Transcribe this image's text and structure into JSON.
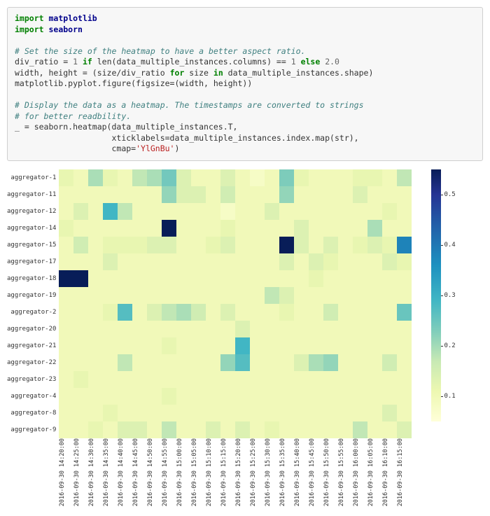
{
  "code": {
    "line1_import": "import",
    "line1_mod": "matplotlib",
    "line2_import": "import",
    "line2_mod": "seaborn",
    "c1": "# Set the size of the heatmap to have a better aspect ratio.",
    "l3a": "div_ratio = ",
    "l3_num1": "1",
    "l3_if": " if ",
    "l3b": "len",
    "l3c": "(data_multiple_instances.columns) == ",
    "l3_num1b": "1",
    "l3_else": " else ",
    "l3_num2": "2.0",
    "l4a": "width, height = (size/div_ratio ",
    "l4_for": "for",
    "l4b": " size ",
    "l4_in": "in",
    "l4c": " data_multiple_instances.shape)",
    "l5": "matplotlib.pyplot.figure(figsize=(width, height))",
    "c2": "# Display the data as a heatmap. The timestamps are converted to strings",
    "c3": "# for better readbility.",
    "l6": "_ = seaborn.heatmap(data_multiple_instances.T,",
    "l7a": "                    xticklabels=data_multiple_instances.index.map(",
    "l7b": "str",
    "l7c": "),",
    "l8a": "                    cmap=",
    "l8s": "'YlGnBu'",
    "l8b": ")"
  },
  "chart_data": {
    "type": "heatmap",
    "xlabel": "",
    "ylabel": "",
    "title": "",
    "cmap": "YlGnBu",
    "vmin": 0.05,
    "vmax": 0.55,
    "colorbar_ticks": [
      0.1,
      0.2,
      0.3,
      0.4,
      0.5
    ],
    "y_categories": [
      "aggregator-1",
      "aggregator-11",
      "aggregator-12",
      "aggregator-14",
      "aggregator-15",
      "aggregator-17",
      "aggregator-18",
      "aggregator-19",
      "aggregator-2",
      "aggregator-20",
      "aggregator-21",
      "aggregator-22",
      "aggregator-23",
      "aggregator-4",
      "aggregator-8",
      "aggregator-9"
    ],
    "x_categories": [
      "2016-09-30 14:20:00",
      "2016-09-30 14:25:00",
      "2016-09-30 14:30:00",
      "2016-09-30 14:35:00",
      "2016-09-30 14:40:00",
      "2016-09-30 14:45:00",
      "2016-09-30 14:50:00",
      "2016-09-30 14:55:00",
      "2016-09-30 15:00:00",
      "2016-09-30 15:05:00",
      "2016-09-30 15:10:00",
      "2016-09-30 15:15:00",
      "2016-09-30 15:20:00",
      "2016-09-30 15:25:00",
      "2016-09-30 15:30:00",
      "2016-09-30 15:35:00",
      "2016-09-30 15:40:00",
      "2016-09-30 15:45:00",
      "2016-09-30 15:50:00",
      "2016-09-30 15:55:00",
      "2016-09-30 16:00:00",
      "2016-09-30 16:05:00",
      "2016-09-30 16:10:00",
      "2016-09-30 16:15:00"
    ],
    "z": [
      [
        0.12,
        0.1,
        0.2,
        0.12,
        0.1,
        0.18,
        0.2,
        0.25,
        0.14,
        0.1,
        0.1,
        0.14,
        0.1,
        0.08,
        0.1,
        0.24,
        0.12,
        0.1,
        0.1,
        0.1,
        0.12,
        0.12,
        0.1,
        0.18
      ],
      [
        0.1,
        0.1,
        0.1,
        0.1,
        0.1,
        0.1,
        0.1,
        0.22,
        0.14,
        0.14,
        0.1,
        0.16,
        0.1,
        0.1,
        0.1,
        0.22,
        0.1,
        0.1,
        0.1,
        0.1,
        0.14,
        0.1,
        0.1,
        0.1
      ],
      [
        0.1,
        0.14,
        0.1,
        0.3,
        0.18,
        0.1,
        0.1,
        0.1,
        0.1,
        0.1,
        0.1,
        0.08,
        0.1,
        0.1,
        0.14,
        0.1,
        0.1,
        0.1,
        0.1,
        0.1,
        0.1,
        0.1,
        0.12,
        0.1
      ],
      [
        0.12,
        0.1,
        0.1,
        0.1,
        0.1,
        0.1,
        0.1,
        0.55,
        0.1,
        0.1,
        0.1,
        0.12,
        0.1,
        0.1,
        0.1,
        0.1,
        0.14,
        0.1,
        0.1,
        0.1,
        0.1,
        0.2,
        0.1,
        0.1
      ],
      [
        0.1,
        0.16,
        0.1,
        0.12,
        0.12,
        0.12,
        0.14,
        0.14,
        0.1,
        0.1,
        0.12,
        0.14,
        0.1,
        0.1,
        0.1,
        0.55,
        0.14,
        0.1,
        0.14,
        0.1,
        0.12,
        0.14,
        0.12,
        0.38
      ],
      [
        0.1,
        0.1,
        0.1,
        0.14,
        0.1,
        0.1,
        0.1,
        0.1,
        0.1,
        0.1,
        0.1,
        0.1,
        0.1,
        0.1,
        0.1,
        0.14,
        0.1,
        0.14,
        0.12,
        0.1,
        0.1,
        0.1,
        0.14,
        0.12
      ],
      [
        0.55,
        0.55,
        0.1,
        0.1,
        0.1,
        0.1,
        0.1,
        0.1,
        0.1,
        0.1,
        0.1,
        0.1,
        0.1,
        0.1,
        0.1,
        0.1,
        0.1,
        0.12,
        0.1,
        0.1,
        0.1,
        0.1,
        0.1,
        0.1
      ],
      [
        0.1,
        0.1,
        0.1,
        0.1,
        0.1,
        0.1,
        0.1,
        0.1,
        0.1,
        0.1,
        0.1,
        0.1,
        0.1,
        0.1,
        0.18,
        0.14,
        0.1,
        0.1,
        0.1,
        0.1,
        0.1,
        0.1,
        0.1,
        0.1
      ],
      [
        0.1,
        0.1,
        0.1,
        0.12,
        0.28,
        0.1,
        0.14,
        0.18,
        0.2,
        0.16,
        0.1,
        0.14,
        0.1,
        0.1,
        0.1,
        0.12,
        0.1,
        0.1,
        0.16,
        0.1,
        0.1,
        0.1,
        0.1,
        0.26
      ],
      [
        0.1,
        0.1,
        0.1,
        0.1,
        0.1,
        0.1,
        0.1,
        0.1,
        0.1,
        0.1,
        0.1,
        0.1,
        0.14,
        0.1,
        0.1,
        0.1,
        0.1,
        0.1,
        0.1,
        0.1,
        0.1,
        0.1,
        0.1,
        0.1
      ],
      [
        0.1,
        0.1,
        0.1,
        0.1,
        0.1,
        0.1,
        0.1,
        0.12,
        0.1,
        0.1,
        0.1,
        0.1,
        0.3,
        0.1,
        0.1,
        0.1,
        0.1,
        0.1,
        0.1,
        0.1,
        0.1,
        0.1,
        0.1,
        0.1
      ],
      [
        0.1,
        0.1,
        0.1,
        0.1,
        0.18,
        0.1,
        0.1,
        0.1,
        0.1,
        0.1,
        0.1,
        0.22,
        0.28,
        0.1,
        0.1,
        0.1,
        0.14,
        0.2,
        0.22,
        0.1,
        0.1,
        0.1,
        0.16,
        0.1
      ],
      [
        0.1,
        0.12,
        0.1,
        0.1,
        0.1,
        0.1,
        0.1,
        0.1,
        0.1,
        0.1,
        0.1,
        0.1,
        0.1,
        0.1,
        0.1,
        0.1,
        0.1,
        0.1,
        0.1,
        0.1,
        0.1,
        0.1,
        0.1,
        0.1
      ],
      [
        0.1,
        0.1,
        0.1,
        0.1,
        0.1,
        0.1,
        0.1,
        0.12,
        0.1,
        0.1,
        0.1,
        0.1,
        0.1,
        0.1,
        0.1,
        0.1,
        0.1,
        0.1,
        0.1,
        0.1,
        0.1,
        0.1,
        0.1,
        0.1
      ],
      [
        0.1,
        0.1,
        0.1,
        0.12,
        0.1,
        0.1,
        0.1,
        0.1,
        0.1,
        0.1,
        0.1,
        0.1,
        0.1,
        0.1,
        0.1,
        0.1,
        0.1,
        0.1,
        0.1,
        0.1,
        0.1,
        0.1,
        0.14,
        0.1
      ],
      [
        0.1,
        0.1,
        0.12,
        0.1,
        0.14,
        0.14,
        0.1,
        0.18,
        0.1,
        0.1,
        0.14,
        0.1,
        0.14,
        0.1,
        0.12,
        0.1,
        0.1,
        0.1,
        0.1,
        0.1,
        0.18,
        0.1,
        0.1,
        0.14
      ]
    ]
  }
}
